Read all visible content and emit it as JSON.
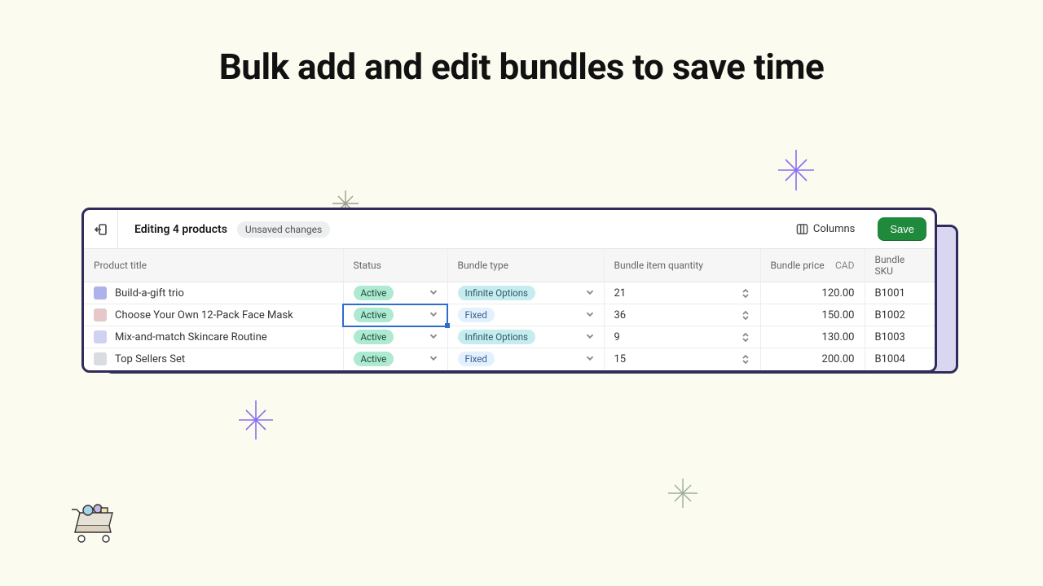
{
  "headline": "Bulk add and edit bundles to save time",
  "toolbar": {
    "title": "Editing 4 products",
    "unsaved_label": "Unsaved changes",
    "columns_label": "Columns",
    "save_label": "Save"
  },
  "columns": {
    "product_title": "Product title",
    "status": "Status",
    "bundle_type": "Bundle type",
    "bundle_qty": "Bundle item quantity",
    "bundle_price": "Bundle price",
    "currency": "CAD",
    "bundle_sku": "Bundle SKU"
  },
  "status_labels": {
    "active": "Active"
  },
  "type_labels": {
    "infinite": "Infinite Options",
    "fixed": "Fixed"
  },
  "rows": [
    {
      "title": "Build-a-gift trio",
      "status": "active",
      "type": "infinite",
      "qty": "21",
      "price": "120.00",
      "sku": "B1001",
      "thumb": "#aeb2ea"
    },
    {
      "title": "Choose Your Own 12-Pack Face Mask",
      "status": "active",
      "type": "fixed",
      "qty": "36",
      "price": "150.00",
      "sku": "B1002",
      "thumb": "#e6c8c8"
    },
    {
      "title": "Mix-and-match Skincare Routine",
      "status": "active",
      "type": "infinite",
      "qty": "9",
      "price": "130.00",
      "sku": "B1003",
      "thumb": "#cfd2f0"
    },
    {
      "title": "Top Sellers Set",
      "status": "active",
      "type": "fixed",
      "qty": "15",
      "price": "200.00",
      "sku": "B1004",
      "thumb": "#d9dce0"
    }
  ],
  "selected_row_index": 1
}
